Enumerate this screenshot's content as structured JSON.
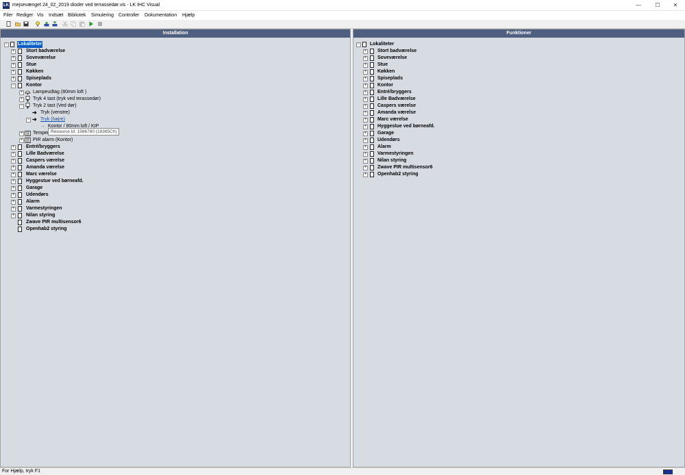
{
  "window": {
    "title": "mejsevænget 24_02_2019 dioder ved terrassedør.vis - LK IHC Visual",
    "app_icon": "LK",
    "min": "—",
    "max": "☐",
    "close": "✕"
  },
  "menu": [
    "Filer",
    "Rediger",
    "Vis",
    "Indsæt",
    "Bibliotek",
    "Simulering",
    "Controller",
    "Dokumentation",
    "Hjælp"
  ],
  "panels": {
    "left_title": "Installation",
    "right_title": "Funktioner"
  },
  "left_tree": {
    "root": "Lokaliteter",
    "rooms": [
      "Stort badværelse",
      "Soveværelse",
      "Stue",
      "Køkken",
      "Spiseplads",
      "Kontor",
      "Entré/bryggers",
      "Lille Badværelse",
      "Caspers værelse",
      "Amanda værelse",
      "Marc værelse",
      "Hyggestue ved børneafd.",
      "Garage",
      "Udendørs",
      "Alarm",
      "Varmestyringen",
      "Nilan styring",
      "Zwave PIR multisensor6",
      "Openhab2 styring"
    ],
    "kontor_children": [
      "Lampeudtag (80mm loft )",
      "Tryk 4 tast (tryk ved terassedør)",
      "Tryk 2 tast (Ved dør)",
      "Tryk (venstre)",
      "Tryk (højre)",
      "Kontor / 80mm loft / KIP",
      "Temper",
      "PIR alarm (Kontor)"
    ],
    "tooltip": "Resource Id: 1586780 (18365Ch)"
  },
  "right_tree": {
    "root": "Lokaliteter",
    "rooms": [
      "Stort badværelse",
      "Soveværelse",
      "Stue",
      "Køkken",
      "Spiseplads",
      "Kontor",
      "Entré/bryggers",
      "Lille Badværelse",
      "Caspers værelse",
      "Amanda værelse",
      "Marc værelse",
      "Hyggestue ved børneafd.",
      "Garage",
      "Udendørs",
      "Alarm",
      "Varmestyringen",
      "Nilan styring",
      "Zwave PIR multisensor6",
      "Openhab2 styring"
    ]
  },
  "status": {
    "text": "For Hjælp, tryk F1"
  }
}
